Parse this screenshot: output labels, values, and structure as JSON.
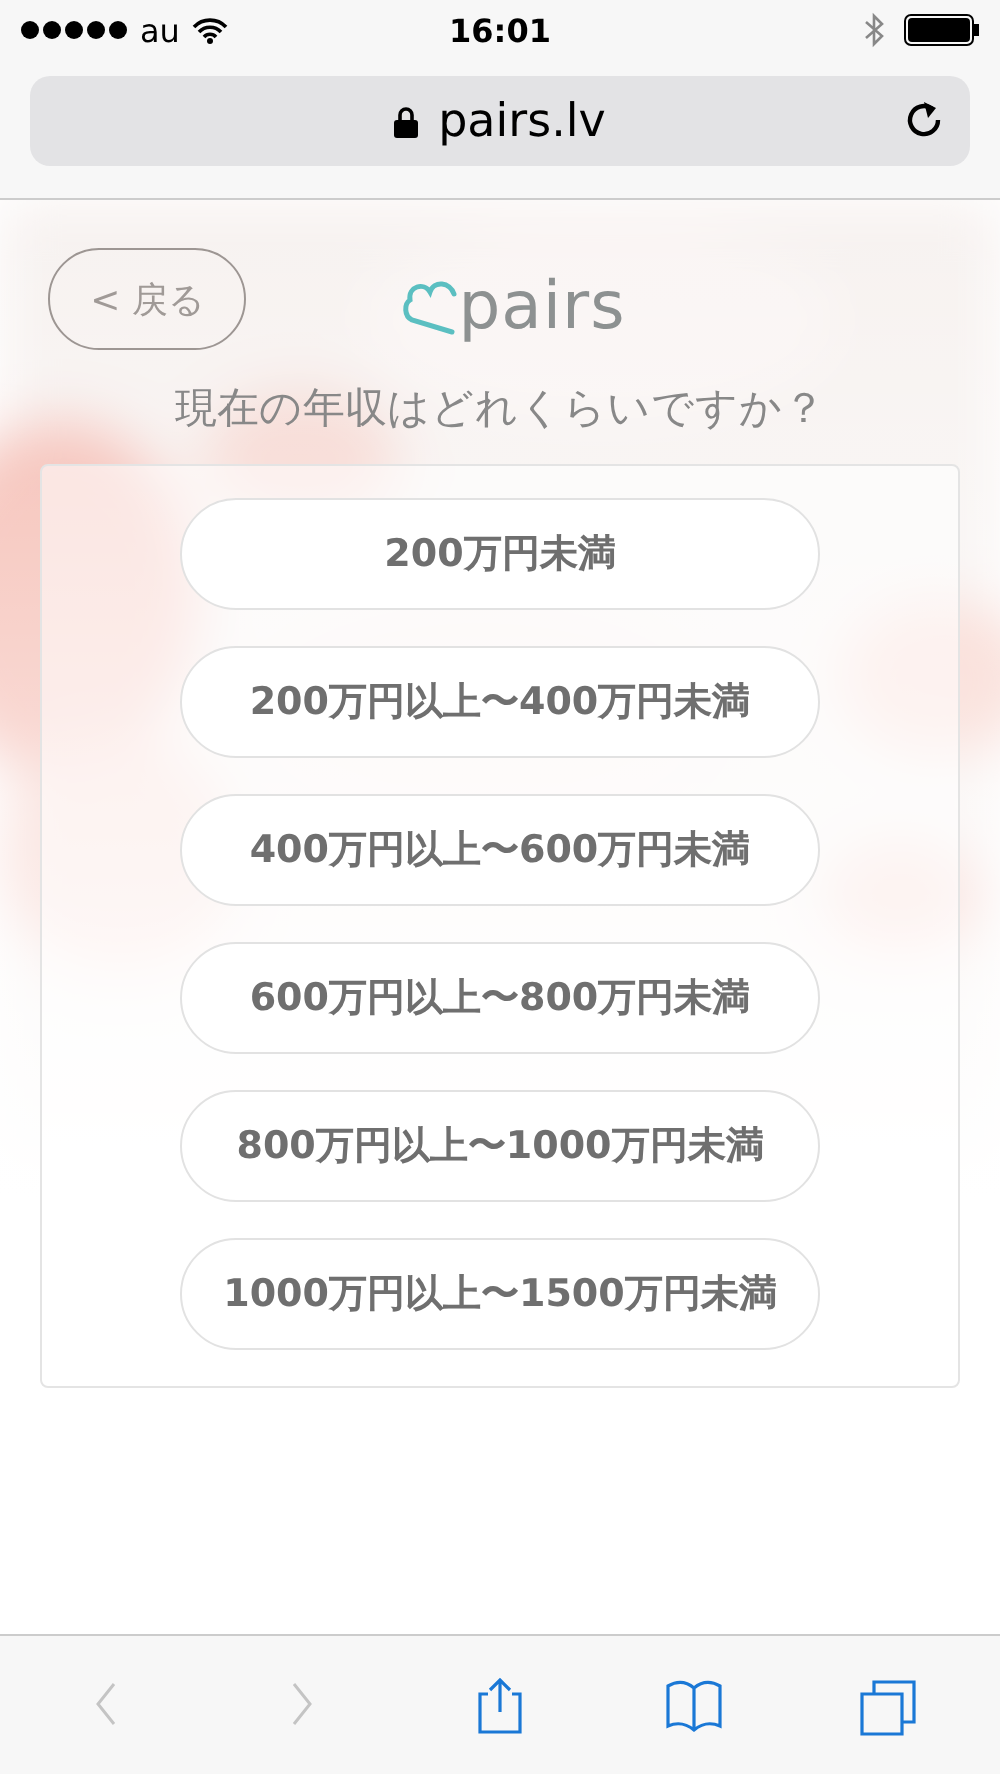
{
  "status_bar": {
    "carrier": "au",
    "time": "16:01"
  },
  "url_bar": {
    "address": "pairs.lv"
  },
  "header": {
    "back_button": "< 戻る",
    "logo": "pairs"
  },
  "question": "現在の年収はどれくらいですか？",
  "options": [
    {
      "label": "200万円未満"
    },
    {
      "label": "200万円以上〜400万円未満"
    },
    {
      "label": "400万円以上〜600万円未満"
    },
    {
      "label": "600万円以上〜800万円未満"
    },
    {
      "label": "800万円以上〜1000万円未満"
    },
    {
      "label": "1000万円以上〜1500万円未満"
    }
  ],
  "toolbar": [
    {
      "kind": "back",
      "disabled": true
    },
    {
      "kind": "forward",
      "disabled": true
    },
    {
      "kind": "share",
      "disabled": false
    },
    {
      "kind": "bookmarks",
      "disabled": false
    },
    {
      "kind": "tabs",
      "disabled": false
    }
  ]
}
